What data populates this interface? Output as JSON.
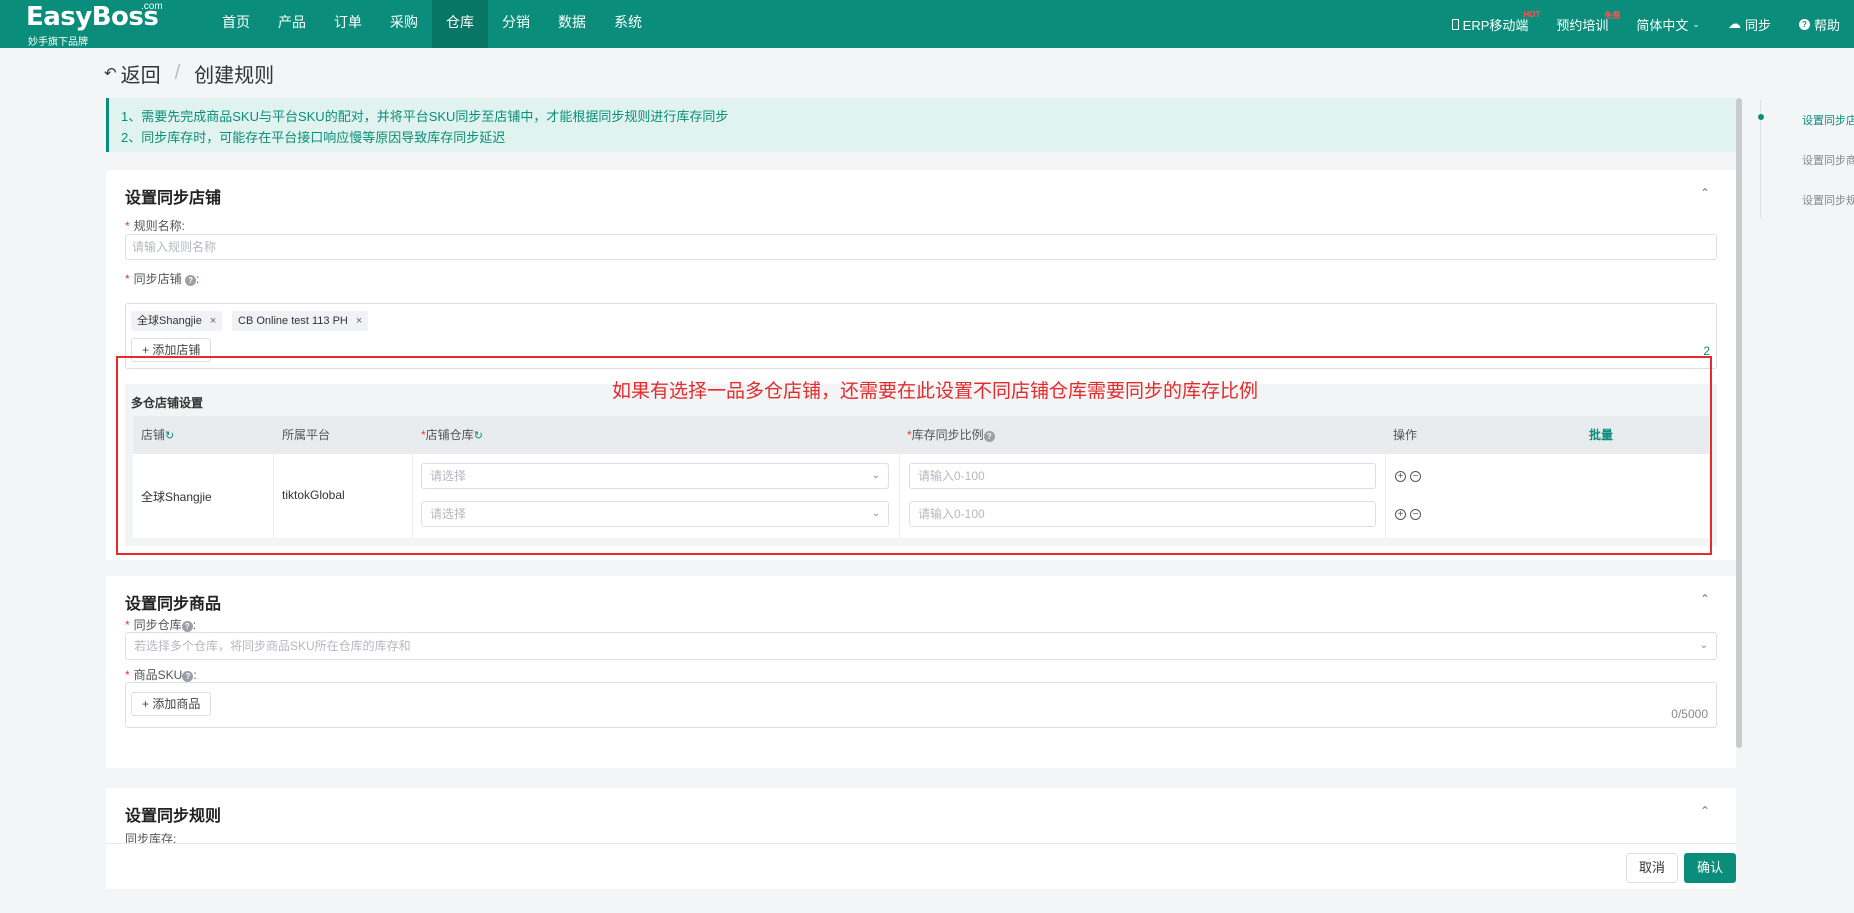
{
  "app": {
    "logo_brand": "EasyBoss",
    "logo_com": ".com",
    "logo_slogan": "妙手旗下品牌"
  },
  "nav": {
    "items": [
      "首页",
      "产品",
      "订单",
      "采购",
      "仓库",
      "分销",
      "数据",
      "系统"
    ],
    "active": "仓库"
  },
  "topright": {
    "erp": "ERP移动端",
    "erp_badge": "HOT",
    "training": "预约培训",
    "training_badge": "免费",
    "lang": "简体中文",
    "sync": "同步",
    "help": "帮助"
  },
  "breadcrumb": {
    "back": "返回",
    "sep": "/",
    "current": "创建规则"
  },
  "notice": {
    "line1": "1、需要先完成商品SKU与平台SKU的配对，并将平台SKU同步至店铺中，才能根据同步规则进行库存同步",
    "line2": "2、同步库存时，可能存在平台接口响应慢等原因导致库存同步延迟"
  },
  "section_store": {
    "title": "设置同步店铺",
    "rule_name_label": "规则名称:",
    "rule_name_placeholder": "请输入规则名称",
    "stores_label": "同步店铺",
    "tags": [
      "全球Shangjie",
      "CB Online test 113 PH"
    ],
    "add_store": "添加店铺",
    "count": "2",
    "multi_title": "多仓店铺设置",
    "columns": {
      "store": "店铺",
      "platform": "所属平台",
      "warehouse": "店铺仓库",
      "ratio": "库存同步比例",
      "batch": "批量",
      "ops": "操作"
    },
    "row": {
      "store": "全球Shangjie",
      "platform": "tiktokGlobal",
      "select_placeholder": "请选择",
      "ratio_placeholder": "请输入0-100"
    }
  },
  "annotation": "如果有选择一品多仓店铺，还需要在此设置不同店铺仓库需要同步的库存比例",
  "section_goods": {
    "title": "设置同步商品",
    "warehouse_label": "同步仓库",
    "warehouse_placeholder": "若选择多个仓库，将同步商品SKU所在仓库的库存和",
    "sku_label": "商品SKU",
    "add_goods": "添加商品",
    "sku_count": "0/5000"
  },
  "section_rule": {
    "title": "设置同步规则",
    "partial_label": "同步库存:"
  },
  "anchor": {
    "items": [
      "设置同步店铺",
      "设置同步商品",
      "设置同步规则"
    ]
  },
  "footer": {
    "cancel": "取消",
    "confirm": "确认"
  },
  "colors": {
    "primary": "#0a8d7a",
    "annotation": "#e52b2b",
    "required": "#e53935"
  }
}
